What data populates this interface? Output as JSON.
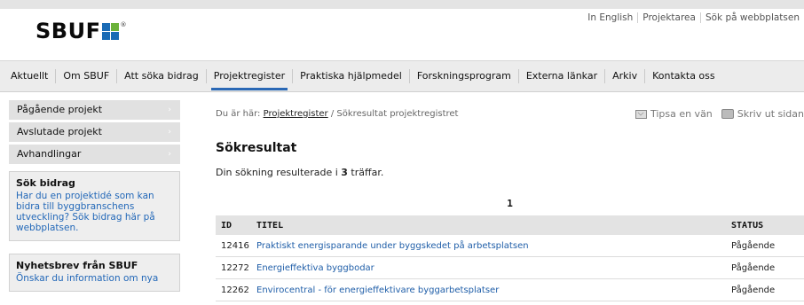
{
  "header": {
    "logo_text": "SBUF",
    "logo_reg": "®",
    "logo_colors": [
      "#1a6bb5",
      "#6bb23a",
      "#1a6bb5",
      "#1a6bb5"
    ],
    "top_links": [
      "In English",
      "Projektarea",
      "Sök på webbplatsen"
    ]
  },
  "nav": {
    "items": [
      "Aktuellt",
      "Om SBUF",
      "Att söka bidrag",
      "Projektregister",
      "Praktiska hjälpmedel",
      "Forskningsprogram",
      "Externa länkar",
      "Arkiv",
      "Kontakta oss"
    ],
    "active": "Projektregister",
    "accent": "#2a68b5"
  },
  "sidebar": {
    "items": [
      {
        "label": "Pågående projekt"
      },
      {
        "label": "Avslutade projekt"
      },
      {
        "label": "Avhandlingar"
      }
    ],
    "bidrag_box": {
      "title": "Sök bidrag",
      "text": "Har du en projektidé som kan bidra till byggbranschens utveckling? Sök bidrag här på webbplatsen."
    },
    "nyhet_box": {
      "title": "Nyhetsbrev från SBUF",
      "text": "Önskar du information om nya"
    }
  },
  "breadcrumb": {
    "prefix": "Du är här:",
    "link": "Projektregister",
    "separator": "/",
    "current": "Sökresultat projektregistret"
  },
  "tools": {
    "tipsa": "Tipsa en vän",
    "print": "Skriv ut sidan"
  },
  "main": {
    "heading": "Sökresultat",
    "summary_before": "Din sökning resulterade i ",
    "summary_count": "3",
    "summary_after": " träffar.",
    "page": "1"
  },
  "table": {
    "headers": {
      "id": "ID",
      "title": "TITEL",
      "status": "STATUS"
    },
    "rows": [
      {
        "id": "12416",
        "title": "Praktiskt energisparande under byggskedet på arbetsplatsen",
        "status": "Pågående"
      },
      {
        "id": "12272",
        "title": "Energieffektiva byggbodar",
        "status": "Pågående"
      },
      {
        "id": "12262",
        "title": "Envirocentral - för energieffektivare byggarbetsplatser",
        "status": "Pågående"
      }
    ]
  }
}
